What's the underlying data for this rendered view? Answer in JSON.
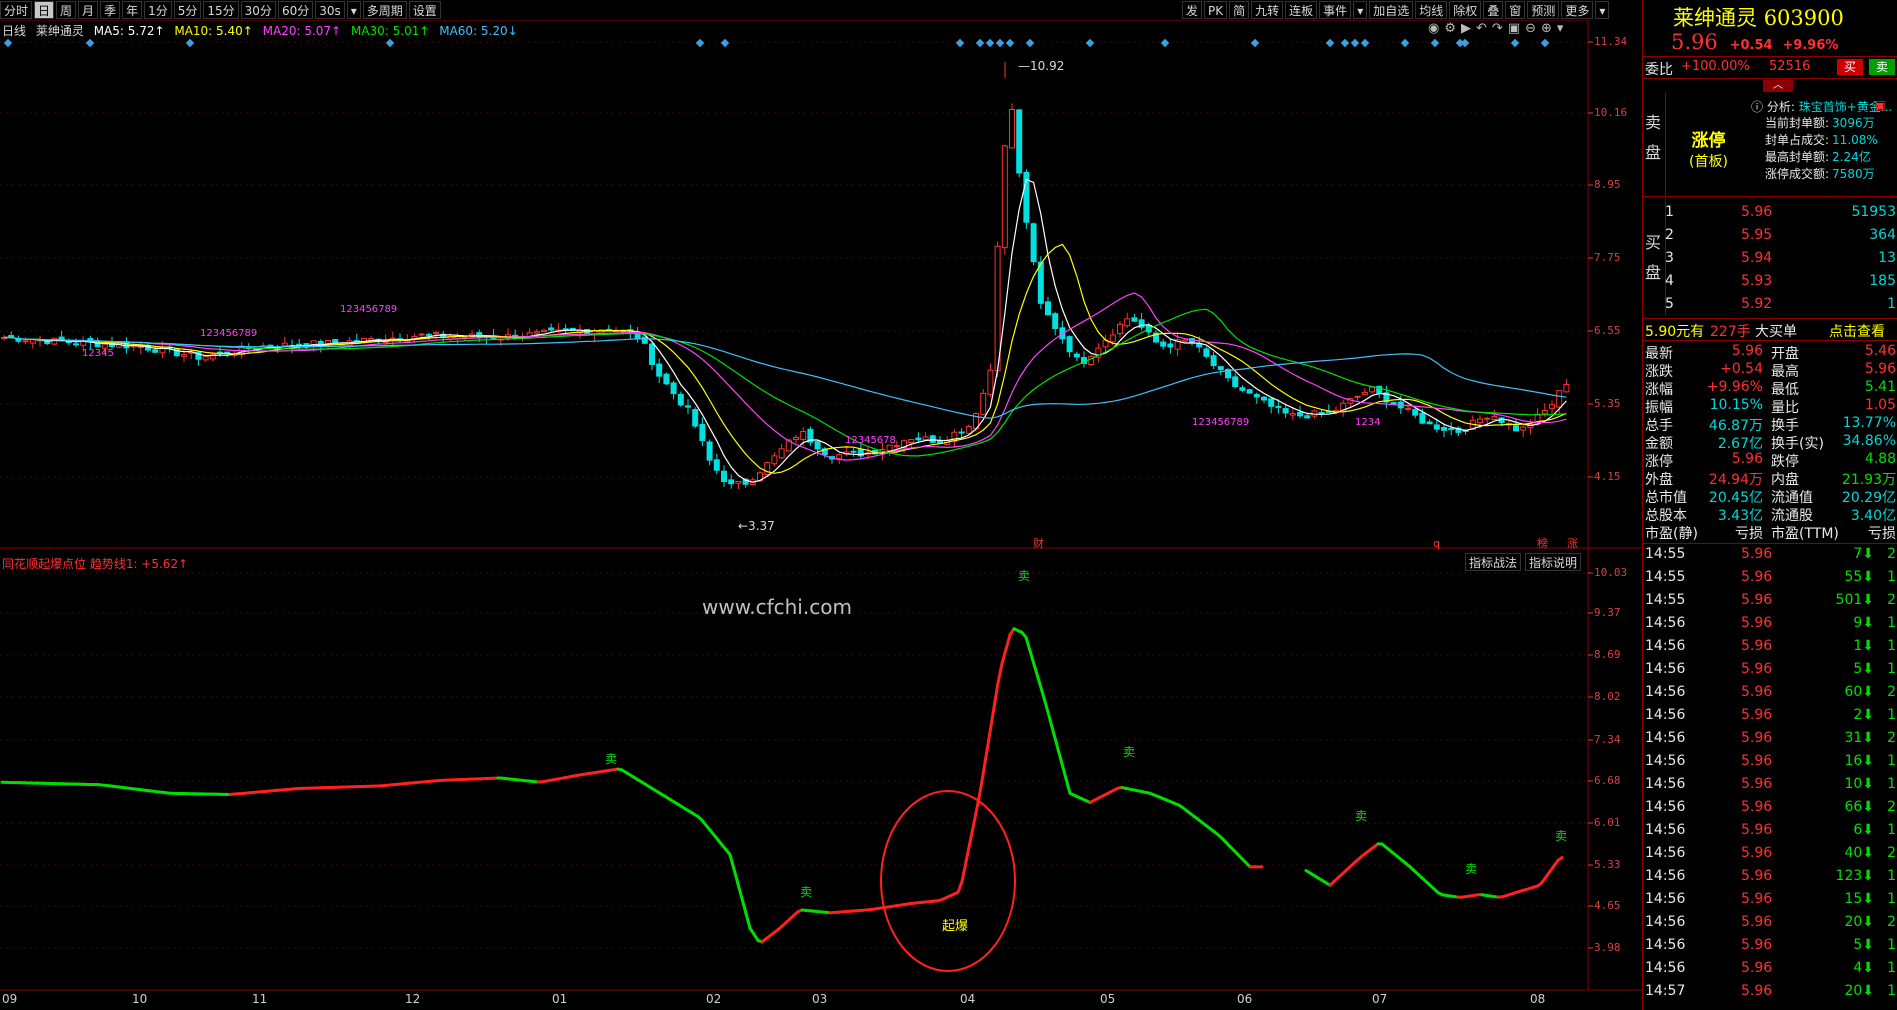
{
  "toolbar": {
    "left": [
      "分时",
      "日",
      "周",
      "月",
      "季",
      "年",
      "1分",
      "5分",
      "15分",
      "30分",
      "60分",
      "30s",
      "▾",
      "多周期",
      "设置"
    ],
    "selected": "日",
    "right": [
      "发",
      "PK",
      "简",
      "九转",
      "连板",
      "事件",
      "▾",
      "加自选",
      "均线",
      "除权",
      "叠",
      "窗",
      "预测",
      "更多",
      "▾"
    ]
  },
  "ma_line": {
    "period": "日线",
    "name": "莱绅通灵",
    "ma5": "MA5: 5.72↑",
    "ma10": "MA10: 5.40↑",
    "ma20": "MA20: 5.07↑",
    "ma30": "MA30: 5.01↑",
    "ma60": "MA60: 5.20↓"
  },
  "colors": {
    "ma5": "#ffffff",
    "ma10": "#ffff00",
    "ma20": "#ff40ff",
    "ma30": "#00e000",
    "ma60": "#40c0ff",
    "up": "#ff3030",
    "down": "#00e0e0",
    "sell": "#00e000",
    "bullish": "#ff2020"
  },
  "price_axis": [
    "11.34",
    "10.16",
    "8.95",
    "7.75",
    "6.55",
    "5.35",
    "4.15"
  ],
  "indicator_axis": [
    "10.03",
    "9.37",
    "8.69",
    "8.02",
    "7.34",
    "6.68",
    "6.01",
    "5.33",
    "4.65",
    "3.98"
  ],
  "x_axis": [
    "09",
    "10",
    "11",
    "12",
    "01",
    "02",
    "03",
    "04",
    "05",
    "06",
    "07",
    "08"
  ],
  "price_labels": {
    "high": "10.92",
    "low": "3.37"
  },
  "event_marks": [
    "财",
    "q",
    "榜",
    "涨"
  ],
  "indicator_title": "同花顺起爆点位  趋势线1: +5.62↑",
  "indicator_buttons": [
    "指标战法",
    "指标说明"
  ],
  "watermark": "www.cfchi.com",
  "annotations": {
    "sell": "卖",
    "explode": "起爆"
  },
  "panel": {
    "name": "莱绅通灵",
    "code": "603900",
    "price": "5.96",
    "change": "+0.54",
    "pct": "+9.96%",
    "weibi_label": "委比",
    "weibi": "+100.00%",
    "weicha": "52516",
    "buy_btn": "买",
    "sell_btn": "卖",
    "sell_side": "卖盘",
    "buy_side": "买盘",
    "limit_up": "涨停",
    "first_board": "(首板)",
    "analysis_label": "分析:",
    "analysis": "珠宝首饰+黄金...",
    "seal_info": [
      {
        "label": "当前封单额:",
        "value": "3096万"
      },
      {
        "label": "封单占成交:",
        "value": "11.08%"
      },
      {
        "label": "最高封单额:",
        "value": "2.24亿"
      },
      {
        "label": "涨停成交额:",
        "value": "7580万"
      }
    ],
    "bids": [
      {
        "level": "1",
        "price": "5.96",
        "vol": "51953"
      },
      {
        "level": "2",
        "price": "5.95",
        "vol": "364"
      },
      {
        "level": "3",
        "price": "5.94",
        "vol": "13"
      },
      {
        "level": "4",
        "price": "5.93",
        "vol": "185"
      },
      {
        "level": "5",
        "price": "5.92",
        "vol": "1"
      }
    ],
    "big_order": {
      "price": "5.90元有",
      "qty": "227手",
      "label": "大买单",
      "link": "点击查看"
    },
    "stats": [
      {
        "l1": "最新",
        "v1": "5.96",
        "c1": "red",
        "l2": "开盘",
        "v2": "5.46",
        "c2": "red"
      },
      {
        "l1": "涨跌",
        "v1": "+0.54",
        "c1": "red",
        "l2": "最高",
        "v2": "5.96",
        "c2": "red"
      },
      {
        "l1": "涨幅",
        "v1": "+9.96%",
        "c1": "red",
        "l2": "最低",
        "v2": "5.41",
        "c2": "green"
      },
      {
        "l1": "振幅",
        "v1": "10.15%",
        "c1": "cyan",
        "l2": "量比",
        "v2": "1.05",
        "c2": "red"
      },
      {
        "l1": "总手",
        "v1": "46.87万",
        "c1": "cyan",
        "l2": "换手",
        "v2": "13.77%",
        "c2": "cyan"
      },
      {
        "l1": "金额",
        "v1": "2.67亿",
        "c1": "cyan",
        "l2": "换手(实)",
        "v2": "34.86%",
        "c2": "cyan"
      },
      {
        "l1": "涨停",
        "v1": "5.96",
        "c1": "red",
        "l2": "跌停",
        "v2": "4.88",
        "c2": "green"
      },
      {
        "l1": "外盘",
        "v1": "24.94万",
        "c1": "red",
        "l2": "内盘",
        "v2": "21.93万",
        "c2": "green"
      },
      {
        "l1": "总市值",
        "v1": "20.45亿",
        "c1": "cyan",
        "l2": "流通值",
        "v2": "20.29亿",
        "c2": "cyan"
      },
      {
        "l1": "总股本",
        "v1": "3.43亿",
        "c1": "cyan",
        "l2": "流通股",
        "v2": "3.40亿",
        "c2": "cyan"
      },
      {
        "l1": "市盈(静)",
        "v1": "亏损",
        "c1": "white",
        "l2": "市盈(TTM)",
        "v2": "亏损",
        "c2": "white"
      }
    ],
    "ticks": [
      {
        "t": "14:55",
        "p": "5.96",
        "v": "7",
        "n": "2"
      },
      {
        "t": "14:55",
        "p": "5.96",
        "v": "55",
        "n": "1"
      },
      {
        "t": "14:55",
        "p": "5.96",
        "v": "501",
        "n": "2"
      },
      {
        "t": "14:56",
        "p": "5.96",
        "v": "9",
        "n": "1"
      },
      {
        "t": "14:56",
        "p": "5.96",
        "v": "1",
        "n": "1"
      },
      {
        "t": "14:56",
        "p": "5.96",
        "v": "5",
        "n": "1"
      },
      {
        "t": "14:56",
        "p": "5.96",
        "v": "60",
        "n": "2"
      },
      {
        "t": "14:56",
        "p": "5.96",
        "v": "2",
        "n": "1"
      },
      {
        "t": "14:56",
        "p": "5.96",
        "v": "31",
        "n": "2"
      },
      {
        "t": "14:56",
        "p": "5.96",
        "v": "16",
        "n": "1"
      },
      {
        "t": "14:56",
        "p": "5.96",
        "v": "10",
        "n": "1"
      },
      {
        "t": "14:56",
        "p": "5.96",
        "v": "66",
        "n": "2"
      },
      {
        "t": "14:56",
        "p": "5.96",
        "v": "6",
        "n": "1"
      },
      {
        "t": "14:56",
        "p": "5.96",
        "v": "40",
        "n": "2"
      },
      {
        "t": "14:56",
        "p": "5.96",
        "v": "123",
        "n": "1"
      },
      {
        "t": "14:56",
        "p": "5.96",
        "v": "15",
        "n": "1"
      },
      {
        "t": "14:56",
        "p": "5.96",
        "v": "20",
        "n": "2"
      },
      {
        "t": "14:56",
        "p": "5.96",
        "v": "5",
        "n": "1"
      },
      {
        "t": "14:56",
        "p": "5.96",
        "v": "4",
        "n": "1"
      },
      {
        "t": "14:57",
        "p": "5.96",
        "v": "20",
        "n": "1"
      }
    ]
  }
}
